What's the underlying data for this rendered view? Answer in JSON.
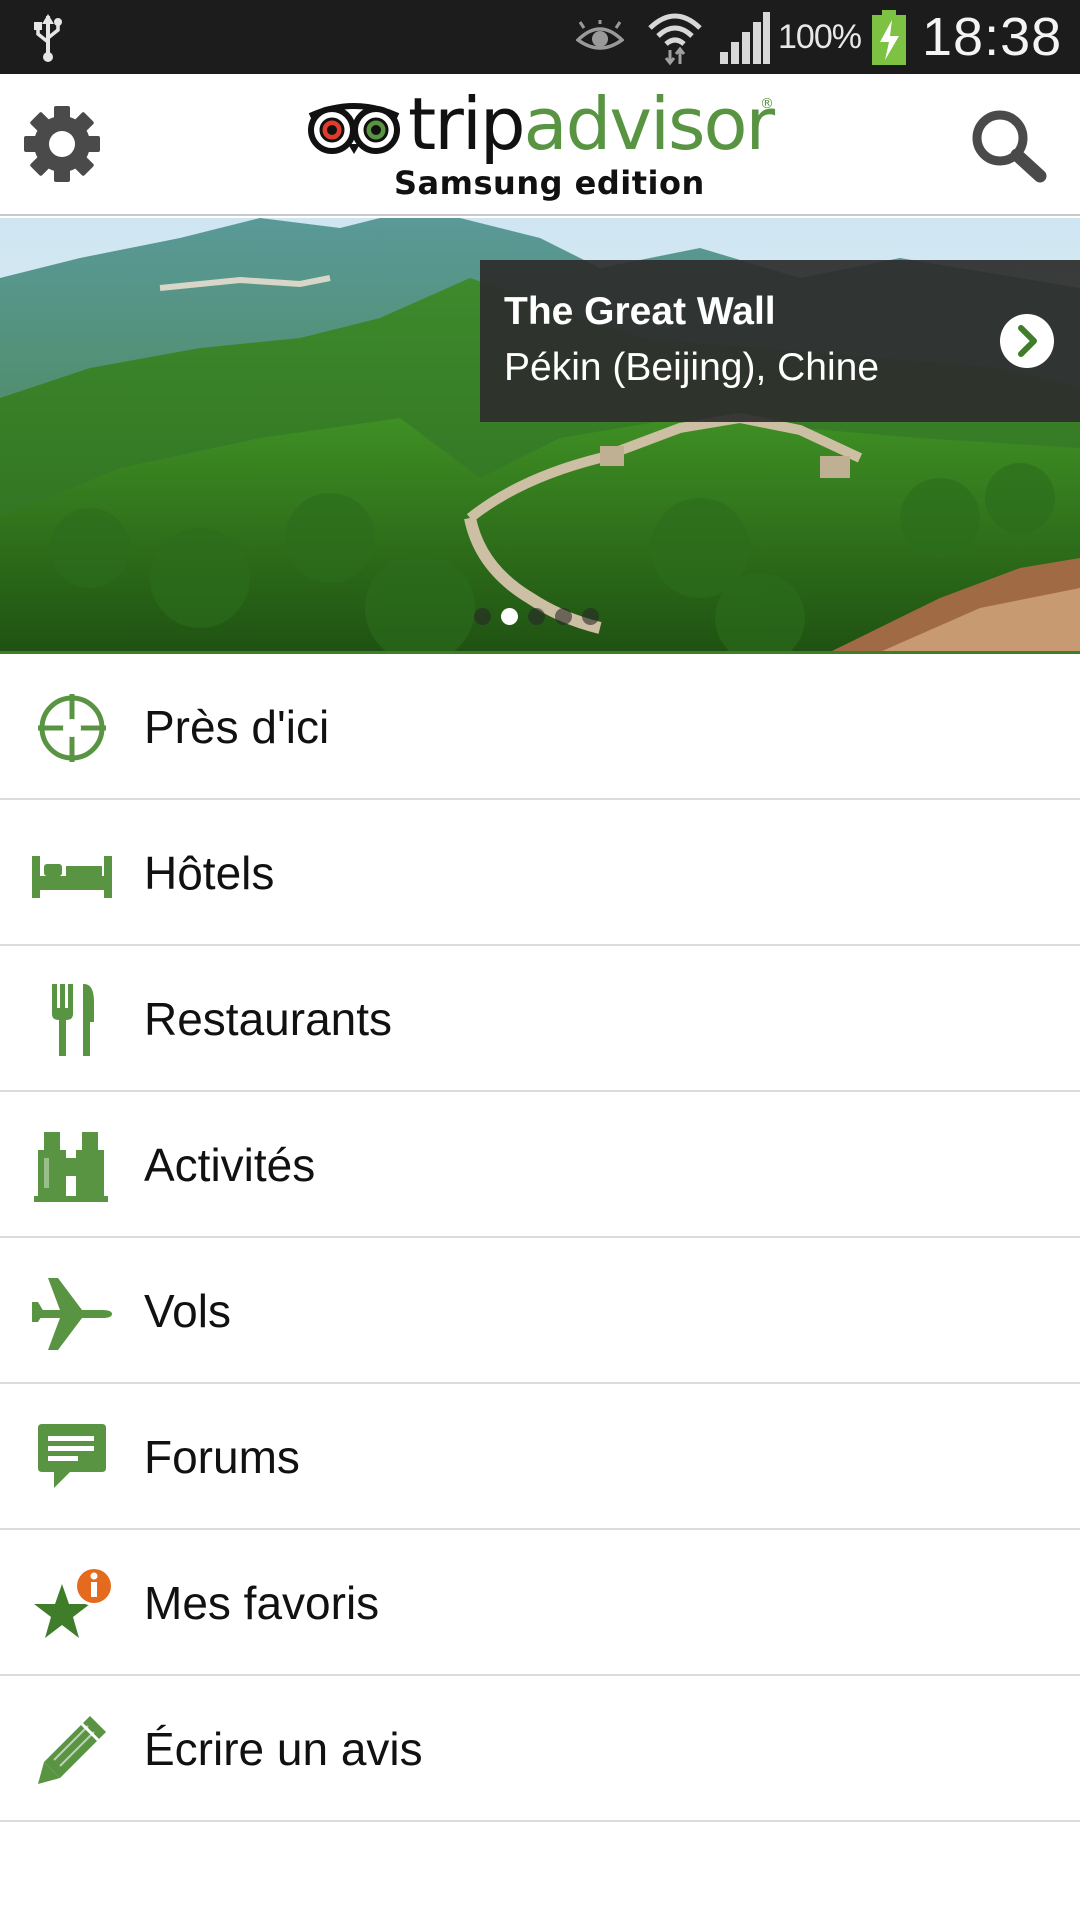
{
  "status_bar": {
    "battery_percent": "100%",
    "time": "18:38",
    "icons": [
      "usb-icon",
      "eye-icon",
      "wifi-icon",
      "signal-icon",
      "battery-charging-icon"
    ]
  },
  "app_bar": {
    "logo_part1": "trip",
    "logo_part2": "advisor",
    "logo_registered": "®",
    "edition": "Samsung edition",
    "left_icon": "gear-icon",
    "right_icon": "search-icon"
  },
  "hero": {
    "title": "The Great Wall",
    "subtitle": "Pékin (Beijing), Chine",
    "carousel_pages": 5,
    "carousel_active_index": 1
  },
  "menu": {
    "items": [
      {
        "label": "Près d'ici",
        "icon": "crosshair-icon"
      },
      {
        "label": "Hôtels",
        "icon": "bed-icon"
      },
      {
        "label": "Restaurants",
        "icon": "fork-knife-icon"
      },
      {
        "label": "Activités",
        "icon": "binoculars-icon"
      },
      {
        "label": "Vols",
        "icon": "airplane-icon"
      },
      {
        "label": "Forums",
        "icon": "chat-bubble-icon"
      },
      {
        "label": "Mes favoris",
        "icon": "star-info-icon"
      },
      {
        "label": "Écrire un avis",
        "icon": "pencil-icon"
      }
    ]
  },
  "colors": {
    "brand_green": "#589442",
    "status_bar": "#1c1c1c",
    "badge_orange": "#e46b1e"
  }
}
